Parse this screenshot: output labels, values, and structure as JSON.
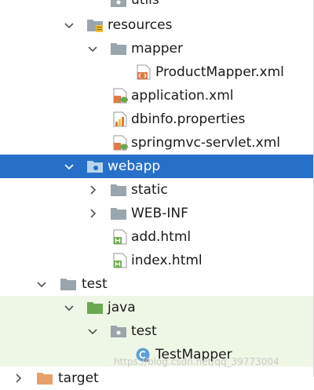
{
  "tree": {
    "utils": "utils",
    "resources": "resources",
    "mapper": "mapper",
    "product_mapper": "ProductMapper.xml",
    "application_xml": "application.xml",
    "dbinfo": "dbinfo.properties",
    "springmvc": "springmvc-servlet.xml",
    "webapp": "webapp",
    "static": "static",
    "webinf": "WEB-INF",
    "add_html": "add.html",
    "index_html": "index.html",
    "test": "test",
    "java": "java",
    "test_pkg": "test",
    "testmapper": "TestMapper",
    "target": "target"
  },
  "watermark": "https://blog.csdn.net/qq_39773004",
  "colors": {
    "selection": "#2770c9",
    "test_root_bg": "#eef6e6",
    "folder_gray": "#9aa5ad",
    "source_green": "#6aa84f",
    "xml_orange": "#e07a45"
  },
  "icons": {
    "folder": "folder-icon",
    "resources_folder": "resources-folder-icon",
    "web_folder": "web-folder-icon",
    "package": "package-icon",
    "xml_file": "xml-file-icon",
    "spring_xml": "spring-xml-icon",
    "properties_file": "properties-file-icon",
    "html_file": "html-file-icon",
    "class_file": "class-icon",
    "expand": "chevron-down-icon",
    "collapse": "chevron-right-icon"
  }
}
